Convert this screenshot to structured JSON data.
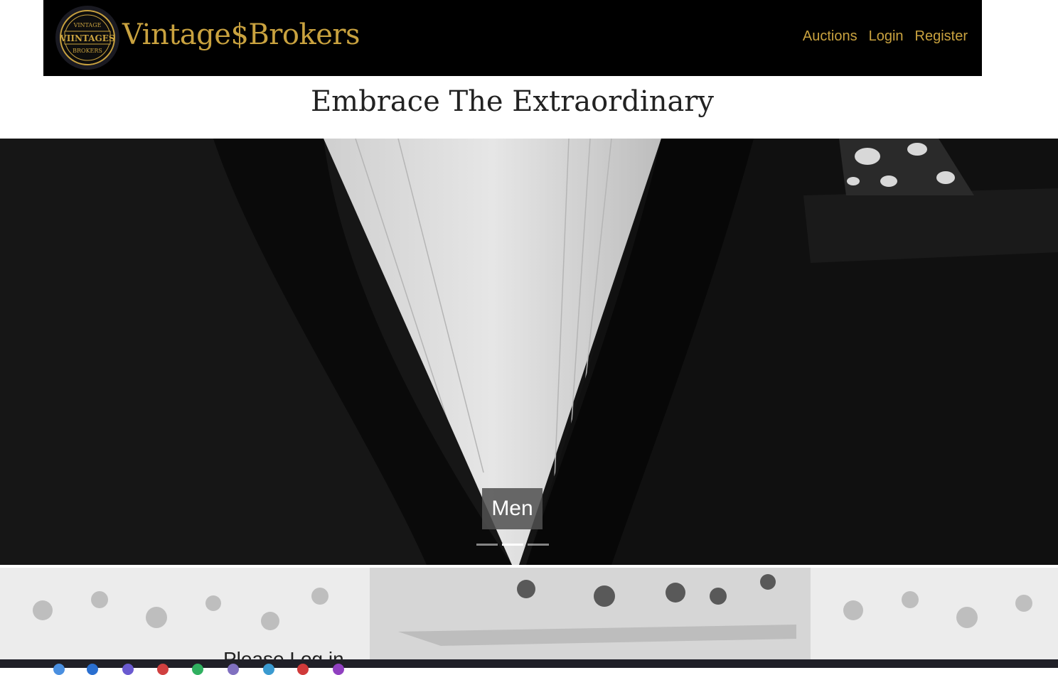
{
  "navbar": {
    "brand": "Vintage$Brokers",
    "logo": {
      "top": "VINTAGE",
      "middle": "VIINTAGES",
      "bottom": "BROKERS"
    },
    "links": [
      {
        "label": "Auctions"
      },
      {
        "label": "Login"
      },
      {
        "label": "Register"
      }
    ],
    "accent_color": "#c9a23f"
  },
  "tagline": "Embrace The Extraordinary",
  "carousel": {
    "caption": "Men",
    "slides": 3,
    "active_index": 1
  },
  "auction_section": {
    "prompt": "Please Log in"
  }
}
